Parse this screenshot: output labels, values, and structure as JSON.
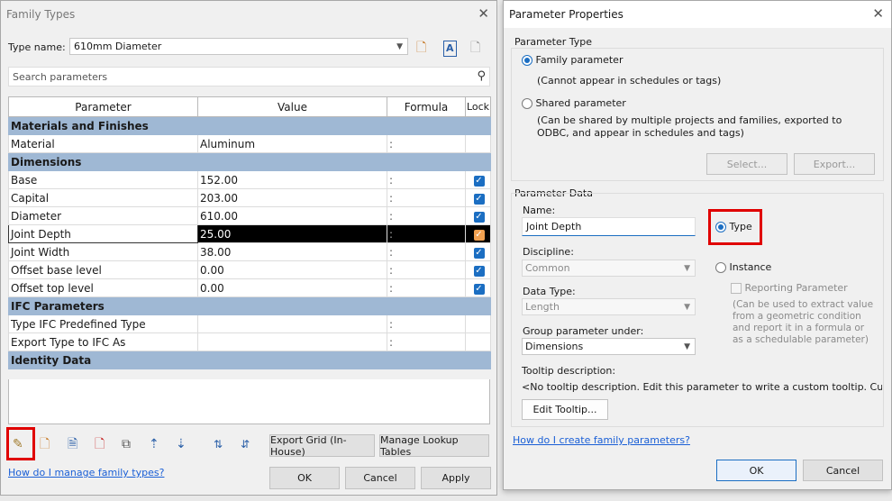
{
  "family_types": {
    "title": "Family Types",
    "type_name_label": "Type name:",
    "type_name_value": "610mm Diameter",
    "search_placeholder": "Search parameters",
    "columns": [
      "Parameter",
      "Value",
      "Formula",
      "Lock"
    ],
    "groups": [
      {
        "name": "Materials and Finishes",
        "rows": [
          {
            "param": "Material",
            "value": "Aluminum",
            "lock": false
          }
        ]
      },
      {
        "name": "Dimensions",
        "rows": [
          {
            "param": "Base",
            "value": "152.00",
            "lock": true
          },
          {
            "param": "Capital",
            "value": "203.00",
            "lock": true
          },
          {
            "param": "Diameter",
            "value": "610.00",
            "lock": true
          },
          {
            "param": "Joint Depth",
            "value": "25.00",
            "lock": true,
            "selected": true
          },
          {
            "param": "Joint Width",
            "value": "38.00",
            "lock": true
          },
          {
            "param": "Offset base level",
            "value": "0.00",
            "lock": true
          },
          {
            "param": "Offset top level",
            "value": "0.00",
            "lock": true
          }
        ]
      },
      {
        "name": "IFC Parameters",
        "rows": [
          {
            "param": "Type IFC Predefined Type",
            "value": "",
            "lock": false
          },
          {
            "param": "Export Type to IFC As",
            "value": "",
            "lock": false
          }
        ]
      },
      {
        "name": "Identity Data",
        "rows": []
      }
    ],
    "export_grid_label": "Export Grid (In-House)",
    "manage_lookup_label": "Manage Lookup Tables",
    "help_link": "How do I manage family types?",
    "ok_label": "OK",
    "cancel_label": "Cancel",
    "apply_label": "Apply"
  },
  "param_props": {
    "title": "Parameter Properties",
    "param_type_group": "Parameter Type",
    "family_param_label": "Family parameter",
    "family_param_note": "(Cannot appear in schedules or tags)",
    "shared_param_label": "Shared parameter",
    "shared_param_note": "(Can be shared by multiple projects and families, exported to ODBC, and appear in schedules and tags)",
    "select_label": "Select...",
    "export_label": "Export...",
    "param_data_group": "Parameter Data",
    "name_label": "Name:",
    "name_value": "Joint Depth",
    "discipline_label": "Discipline:",
    "discipline_value": "Common",
    "datatype_label": "Data Type:",
    "datatype_value": "Length",
    "group_under_label": "Group parameter under:",
    "group_under_value": "Dimensions",
    "type_label": "Type",
    "instance_label": "Instance",
    "reporting_label": "Reporting Parameter",
    "reporting_note": "(Can be used to extract value from a geometric condition and report it in a formula or as a schedulable parameter)",
    "tooltip_label": "Tooltip description:",
    "tooltip_value": "<No tooltip description. Edit this parameter to write a custom tooltip. Custom",
    "edit_tooltip_label": "Edit Tooltip...",
    "help_link": "How do I create family parameters?",
    "ok_label": "OK",
    "cancel_label": "Cancel"
  },
  "colors": {
    "group_header": "#9fb8d4",
    "accent": "#1b6ec2",
    "highlight": "#e00000"
  }
}
